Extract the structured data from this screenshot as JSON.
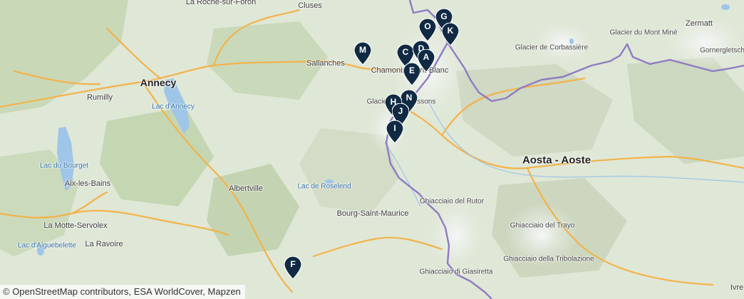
{
  "map": {
    "colors": {
      "land": "#dfe7d6",
      "forest": "#c7d8b6",
      "relief_dark": "#b7c6a8",
      "snow": "#f3f5f6",
      "water": "#9fc5e8",
      "road": "#f2b34a",
      "border": "#8f7bc4",
      "marker": "#102a43"
    },
    "places": [
      {
        "name": "La Roche-sur-Foron",
        "kind": "town"
      },
      {
        "name": "Cluses",
        "kind": "town"
      },
      {
        "name": "Sallanches",
        "kind": "town"
      },
      {
        "name": "Chamonix-Mont-Blanc",
        "kind": "town"
      },
      {
        "name": "Annecy",
        "kind": "city"
      },
      {
        "name": "Rumilly",
        "kind": "town"
      },
      {
        "name": "Lac d'Annecy",
        "kind": "water"
      },
      {
        "name": "Lac du Bourget",
        "kind": "water"
      },
      {
        "name": "Aix-les-Bains",
        "kind": "town"
      },
      {
        "name": "La Motte-Servolex",
        "kind": "town"
      },
      {
        "name": "Lac d'Aiguebelette",
        "kind": "water"
      },
      {
        "name": "La Ravoire",
        "kind": "town"
      },
      {
        "name": "Albertville",
        "kind": "town"
      },
      {
        "name": "Lac de Roselend",
        "kind": "water"
      },
      {
        "name": "Bourg-Saint-Maurice",
        "kind": "town"
      },
      {
        "name": "Aosta - Aoste",
        "kind": "region"
      },
      {
        "name": "Zermatt",
        "kind": "town"
      },
      {
        "name": "Glacier du Mont Miné",
        "kind": "glacier"
      },
      {
        "name": "Glacier de Corbassière",
        "kind": "glacier"
      },
      {
        "name": "Gornergletscher",
        "kind": "glacier"
      },
      {
        "name": "Ghiacciaio del Rutor",
        "kind": "glacier"
      },
      {
        "name": "Ghiacciaio del Trayo",
        "kind": "glacier"
      },
      {
        "name": "Ghiacciaio della Tribolazione",
        "kind": "glacier"
      },
      {
        "name": "Ghiacciaio di Giasiretta",
        "kind": "glacier"
      },
      {
        "name": "Ivre",
        "kind": "town"
      },
      {
        "name": "Glaciers des Bossons",
        "kind": "glacier"
      }
    ],
    "markers": [
      {
        "label": "G"
      },
      {
        "label": "K"
      },
      {
        "label": "O"
      },
      {
        "label": "M"
      },
      {
        "label": "C"
      },
      {
        "label": "D"
      },
      {
        "label": "A"
      },
      {
        "label": "E"
      },
      {
        "label": "N"
      },
      {
        "label": "H"
      },
      {
        "label": "J"
      },
      {
        "label": "I"
      },
      {
        "label": "F"
      }
    ]
  },
  "attribution": "© OpenStreetMap contributors, ESA WorldCover, Mapzen"
}
